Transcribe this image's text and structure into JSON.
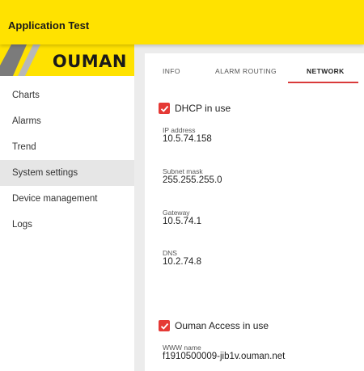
{
  "header": {
    "title": "Application Test"
  },
  "logo": {
    "text": "OUMAN"
  },
  "sidebar": {
    "items": [
      {
        "label": "Charts"
      },
      {
        "label": "Alarms"
      },
      {
        "label": "Trend"
      },
      {
        "label": "System settings",
        "active": true
      },
      {
        "label": "Device management"
      },
      {
        "label": "Logs"
      }
    ]
  },
  "tabs": [
    {
      "label": "INFO"
    },
    {
      "label": "ALARM ROUTING"
    },
    {
      "label": "NETWORK",
      "active": true
    }
  ],
  "network": {
    "dhcp": {
      "label": "DHCP in use",
      "checked": true
    },
    "ip_address": {
      "label": "IP address",
      "value": "10.5.74.158"
    },
    "subnet_mask": {
      "label": "Subnet mask",
      "value": "255.255.255.0"
    },
    "gateway": {
      "label": "Gateway",
      "value": "10.5.74.1"
    },
    "dns": {
      "label": "DNS",
      "value": "10.2.74.8"
    },
    "ouman_access": {
      "label": "Ouman Access in use",
      "checked": true
    },
    "www_name": {
      "label": "WWW name",
      "value": "f1910500009-jib1v.ouman.net"
    }
  },
  "colors": {
    "brand_yellow": "#ffe200",
    "accent_red": "#e53935",
    "active_nav": "#e6e6e6"
  }
}
